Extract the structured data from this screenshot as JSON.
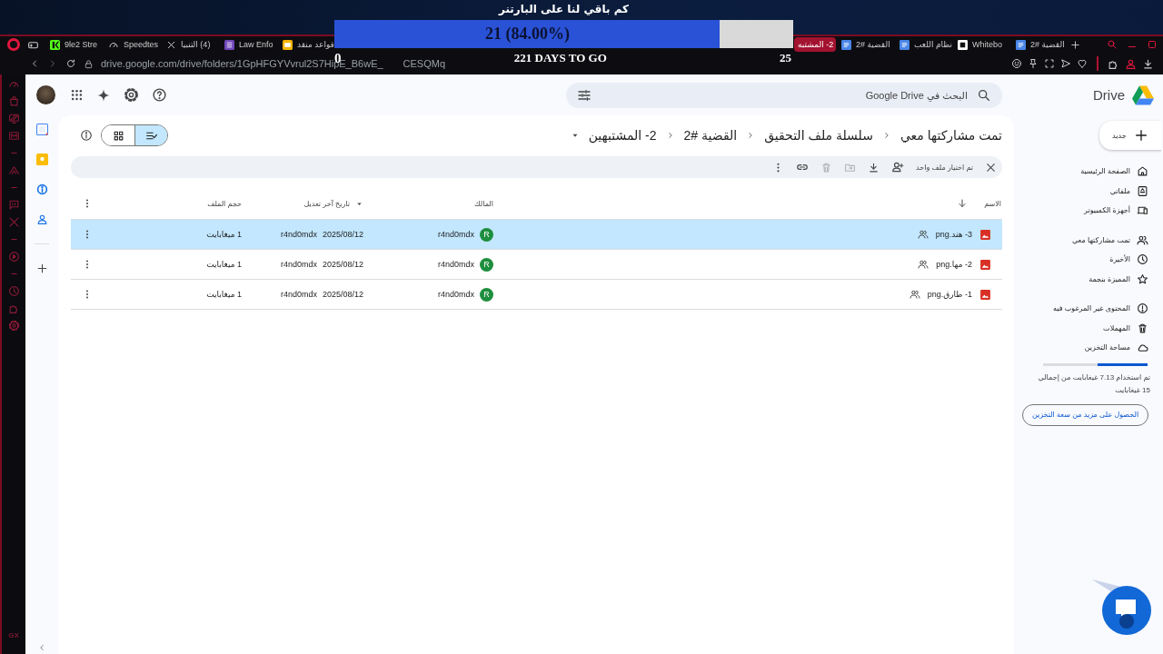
{
  "overlay": {
    "title": "كم باقي لنا على البارتنر",
    "progress": {
      "label": "21 (84.00%)",
      "level": 0.84
    },
    "start": "0",
    "caption": "221 DAYS TO GO",
    "end": "25"
  },
  "browser": {
    "tabs_left": [
      {
        "label": "قواعد منقد",
        "kind": "slides",
        "selected": false
      },
      {
        "label": "Law Enfo",
        "kind": "form",
        "selected": false
      },
      {
        "label": "(4) التنبيا",
        "kind": "cross",
        "selected": false
      },
      {
        "label": "Speedtes",
        "kind": "gauge",
        "selected": false
      },
      {
        "label": "9le2 Stre",
        "kind": "green",
        "selected": false
      }
    ],
    "tabs_right": [
      {
        "label": "القضية #2",
        "kind": "doc",
        "selected": false
      },
      {
        "label": "Whitebo",
        "kind": "square",
        "selected": false
      },
      {
        "label": "نظام اللعب",
        "kind": "doc",
        "selected": false
      },
      {
        "label": "القضية #2",
        "kind": "doc",
        "selected": false
      },
      {
        "label": "2- المشتبه",
        "kind": "plain",
        "selected": true
      }
    ],
    "address": {
      "url_start": "drive.google.com/drive/folders/1GpHFGYVvrul2S7HipE_B6wE_",
      "url_end": "CESQMq"
    },
    "sidebar_badge": "GX"
  },
  "drive": {
    "logo": "Drive",
    "search": {
      "placeholder": "البحث في Google Drive"
    },
    "new_button": "جديد",
    "nav_groups": [
      [
        {
          "label": "الصفحة الرئيسية",
          "kind": "home"
        },
        {
          "label": "ملفاتي",
          "kind": "drive"
        },
        {
          "label": "أجهزة الكمبيوتر",
          "kind": "devices"
        }
      ],
      [
        {
          "label": "تمت مشاركتها معي",
          "kind": "people"
        },
        {
          "label": "الأخيرة",
          "kind": "clock"
        },
        {
          "label": "المميزة بنجمة",
          "kind": "star"
        }
      ],
      [
        {
          "label": "المحتوى غير المرغوب فيه",
          "kind": "alert"
        },
        {
          "label": "المهملات",
          "kind": "trash"
        },
        {
          "label": "مساحة التخزين",
          "kind": "cloud"
        }
      ]
    ],
    "storage": {
      "level": 0.475,
      "text": "تم استخدام 7.13 غيغابايت من إجمالي 15 غيغابايت",
      "button": "الحصول على مزيد من سعة التخزين"
    },
    "breadcrumb": [
      "تمت مشاركتها معي",
      "سلسلة ملف التحقيق",
      "القضية #2",
      "2- المشتبهين"
    ],
    "view_toggle": [
      {
        "kind": "grid",
        "selected": false
      },
      {
        "kind": "list",
        "selected": true
      }
    ],
    "selection_bar": {
      "label": "تم اختيار ملف واحد"
    },
    "table": {
      "columns": [
        "الاسم",
        "المالك",
        "تاريخ آخر تعديل",
        "حجم الملف"
      ],
      "rows": [
        {
          "name": "3- هند.png",
          "owner": "r4nd0mdx",
          "owner_initial": "R",
          "modified": "2025/08/12",
          "modified_by": "r4nd0mdx",
          "size": "1 ميغابايت",
          "selected": true
        },
        {
          "name": "2- مها.png",
          "owner": "r4nd0mdx",
          "owner_initial": "R",
          "modified": "2025/08/12",
          "modified_by": "r4nd0mdx",
          "size": "1 ميغابايت",
          "selected": false
        },
        {
          "name": "1- طارق.png",
          "owner": "r4nd0mdx",
          "owner_initial": "R",
          "modified": "2025/08/12",
          "modified_by": "r4nd0mdx",
          "size": "1 ميغابايت",
          "selected": false
        }
      ]
    }
  }
}
